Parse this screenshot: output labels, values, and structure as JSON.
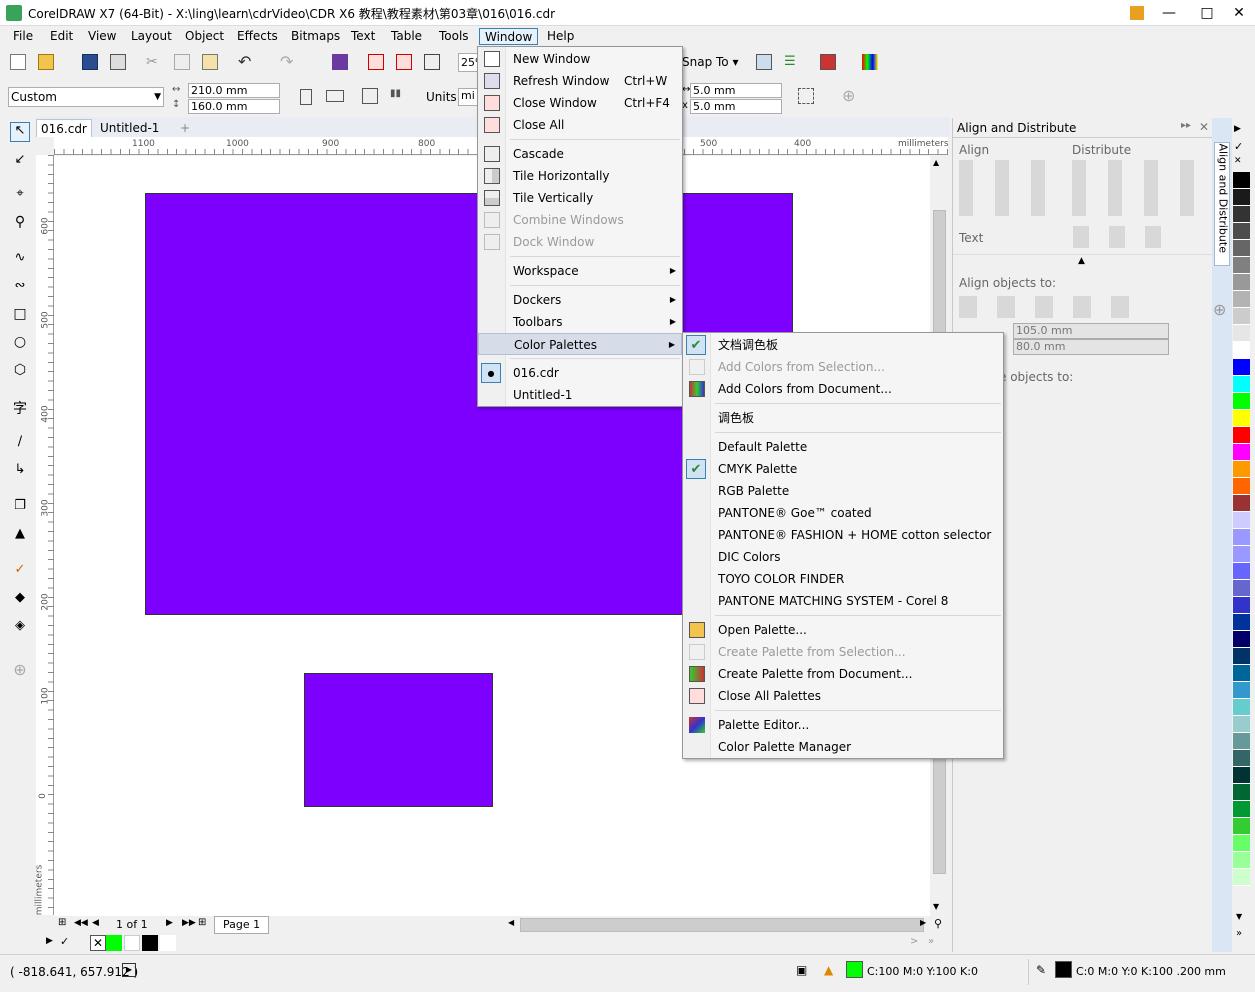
{
  "titlebar": {
    "title": "CorelDRAW X7 (64-Bit) - X:\\ling\\learn\\cdrVideo\\CDR X6 教程\\教程素材\\第03章\\016\\016.cdr"
  },
  "menubar": [
    "File",
    "Edit",
    "View",
    "Layout",
    "Object",
    "Effects",
    "Bitmaps",
    "Text",
    "Table",
    "Tools",
    "Window",
    "Help"
  ],
  "toolbar1": {
    "zoom_value": "25%",
    "snap_to": "Snap To"
  },
  "toolbar2": {
    "page_preset": "Custom",
    "width": "210.0 mm",
    "height": "160.0 mm",
    "units_label": "Units:",
    "units_value": "mi",
    "nudge_x": "5.0 mm",
    "nudge_y": "5.0 mm"
  },
  "doc_tabs": [
    "016.cdr",
    "Untitled-1"
  ],
  "hruler_ticks": [
    "1100",
    "1000",
    "900",
    "800",
    "500",
    "400"
  ],
  "hruler_unit": "millimeters",
  "vruler_ticks": [
    "600",
    "500",
    "400",
    "300",
    "200",
    "100",
    "0"
  ],
  "vruler_unit": "millimeters",
  "shape_color": "#7d00ff",
  "page_nav": {
    "counter": "1 of 1",
    "page_tab": "Page 1"
  },
  "window_menu": {
    "items": [
      {
        "label": "New Window",
        "shortcut": "",
        "enabled": true
      },
      {
        "label": "Refresh Window",
        "shortcut": "Ctrl+W",
        "enabled": true
      },
      {
        "label": "Close Window",
        "shortcut": "Ctrl+F4",
        "enabled": true
      },
      {
        "label": "Close All",
        "shortcut": "",
        "enabled": true
      },
      {
        "label": "Cascade",
        "shortcut": "",
        "enabled": true
      },
      {
        "label": "Tile Horizontally",
        "shortcut": "",
        "enabled": true
      },
      {
        "label": "Tile Vertically",
        "shortcut": "",
        "enabled": true
      },
      {
        "label": "Combine Windows",
        "shortcut": "",
        "enabled": false
      },
      {
        "label": "Dock Window",
        "shortcut": "",
        "enabled": false
      },
      {
        "label": "Workspace",
        "shortcut": "",
        "enabled": true
      },
      {
        "label": "Dockers",
        "shortcut": "",
        "enabled": true
      },
      {
        "label": "Toolbars",
        "shortcut": "",
        "enabled": true
      },
      {
        "label": "Color Palettes",
        "shortcut": "",
        "enabled": true
      },
      {
        "label": "016.cdr",
        "shortcut": "",
        "enabled": true
      },
      {
        "label": "Untitled-1",
        "shortcut": "",
        "enabled": true
      }
    ]
  },
  "palettes_submenu": {
    "items": [
      {
        "label": "文档调色板",
        "checked": true,
        "enabled": true
      },
      {
        "label": "Add Colors from Selection...",
        "checked": false,
        "enabled": false
      },
      {
        "label": "Add Colors from Document...",
        "checked": false,
        "enabled": true
      },
      {
        "label": "调色板",
        "checked": false,
        "enabled": true
      },
      {
        "label": "Default Palette",
        "checked": false,
        "enabled": true
      },
      {
        "label": "CMYK Palette",
        "checked": true,
        "enabled": true
      },
      {
        "label": "RGB Palette",
        "checked": false,
        "enabled": true
      },
      {
        "label": "PANTONE® Goe™ coated",
        "checked": false,
        "enabled": true
      },
      {
        "label": "PANTONE® FASHION + HOME cotton selector",
        "checked": false,
        "enabled": true
      },
      {
        "label": "DIC Colors",
        "checked": false,
        "enabled": true
      },
      {
        "label": "TOYO COLOR FINDER",
        "checked": false,
        "enabled": true
      },
      {
        "label": "PANTONE MATCHING SYSTEM - Corel 8",
        "checked": false,
        "enabled": true
      },
      {
        "label": "Open Palette...",
        "checked": false,
        "enabled": true
      },
      {
        "label": "Create Palette from Selection...",
        "checked": false,
        "enabled": false
      },
      {
        "label": "Create Palette from Document...",
        "checked": false,
        "enabled": true
      },
      {
        "label": "Close All Palettes",
        "checked": false,
        "enabled": true
      },
      {
        "label": "Palette Editor...",
        "checked": false,
        "enabled": true
      },
      {
        "label": "Color Palette Manager",
        "checked": false,
        "enabled": true
      }
    ]
  },
  "docker": {
    "title": "Align and Distribute",
    "align_label": "Align",
    "distribute_label": "Distribute",
    "text_label": "Text",
    "align_objects_to": "Align objects to:",
    "x_value": "105.0 mm",
    "y_value": "80.0 mm",
    "distribute_objects_to": "e objects to:",
    "vertical_tab": "Align and Distribute"
  },
  "color_palette": [
    "#000000",
    "#1a1a1a",
    "#333333",
    "#4d4d4d",
    "#666666",
    "#808080",
    "#999999",
    "#b3b3b3",
    "#cccccc",
    "#e6e6e6",
    "#ffffff",
    "#0000ff",
    "#00ffff",
    "#00ff00",
    "#ffff00",
    "#ff0000",
    "#ff00ff",
    "#ff9900",
    "#ff6600",
    "#993333",
    "#ccccff",
    "#9999ff",
    "#9999ff",
    "#6666ff",
    "#6666cc",
    "#3333cc",
    "#003399",
    "#000066",
    "#003366",
    "#006699",
    "#3399cc",
    "#66cccc",
    "#99cccc",
    "#669999",
    "#336666",
    "#003333",
    "#006633",
    "#009933",
    "#33cc33",
    "#66ff66",
    "#99ff99",
    "#ccffcc"
  ],
  "status": {
    "coords": "( -818.641, 657.912 )",
    "fill_text": "C:100 M:0 Y:100 K:0",
    "fill_color": "#00ff00",
    "outline_text": "C:0 M:0 Y:0 K:100  .200 mm",
    "outline_color": "#000000"
  }
}
